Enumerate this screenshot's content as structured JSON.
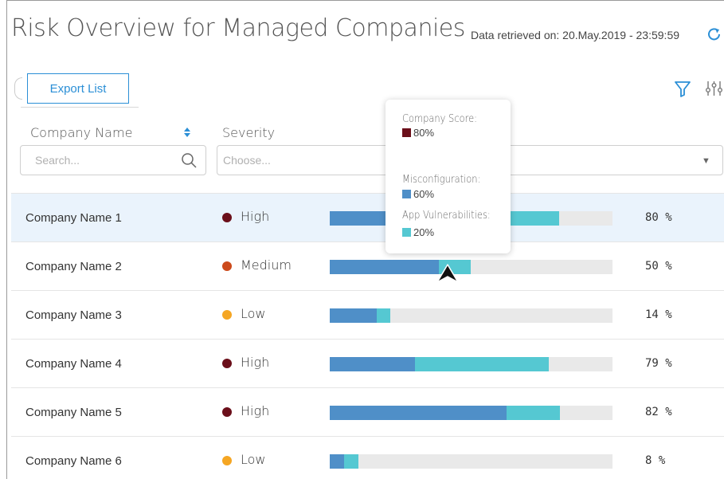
{
  "header": {
    "title": "Risk Overview for Managed Companies",
    "retrieved": "Data retrieved on: 20.May.2019 - 23:59:59",
    "refresh_icon": "refresh-icon"
  },
  "toolbar": {
    "export_label": "Export List",
    "filter_icon": "filter-icon",
    "settings_icon": "column-settings-icon"
  },
  "columns": {
    "company": "Company Name",
    "severity": "Severity",
    "search_placeholder": "Search...",
    "severity_placeholder": "Choose..."
  },
  "colors": {
    "high": "#6b0f1a",
    "medium": "#cc4a1b",
    "low": "#f5a623",
    "misconfiguration": "#4f8fc8",
    "app_vulnerabilities": "#55c8d2",
    "track": "#e9e9e9",
    "accent": "#2b8fd6"
  },
  "rows": [
    {
      "name": "Company Name 1",
      "severity": "High",
      "sev_color": "#6b0f1a",
      "misconfig": 0.38,
      "appvuln": 0.43,
      "score": "80 %",
      "selected": true
    },
    {
      "name": "Company Name 2",
      "severity": "Medium",
      "sev_color": "#cc4a1b",
      "misconfig": 0.385,
      "appvuln": 0.115,
      "score": "50 %",
      "selected": false
    },
    {
      "name": "Company Name 3",
      "severity": "Low",
      "sev_color": "#f5a623",
      "misconfig": 0.165,
      "appvuln": 0.05,
      "score": "14 %",
      "selected": false
    },
    {
      "name": "Company Name 4",
      "severity": "High",
      "sev_color": "#6b0f1a",
      "misconfig": 0.3,
      "appvuln": 0.475,
      "score": "79 %",
      "selected": false
    },
    {
      "name": "Company Name 5",
      "severity": "High",
      "sev_color": "#6b0f1a",
      "misconfig": 0.625,
      "appvuln": 0.19,
      "score": "82 %",
      "selected": false
    },
    {
      "name": "Company Name 6",
      "severity": "Low",
      "sev_color": "#f5a623",
      "misconfig": 0.05,
      "appvuln": 0.05,
      "score": "8 %",
      "selected": false
    }
  ],
  "tooltip": {
    "company_score_label": "Company Score:",
    "company_score_value": "80%",
    "misconfig_label": "Misconfiguration:",
    "misconfig_value": "60%",
    "appvuln_label": "App Vulnerabilities:",
    "appvuln_value": "20%"
  }
}
